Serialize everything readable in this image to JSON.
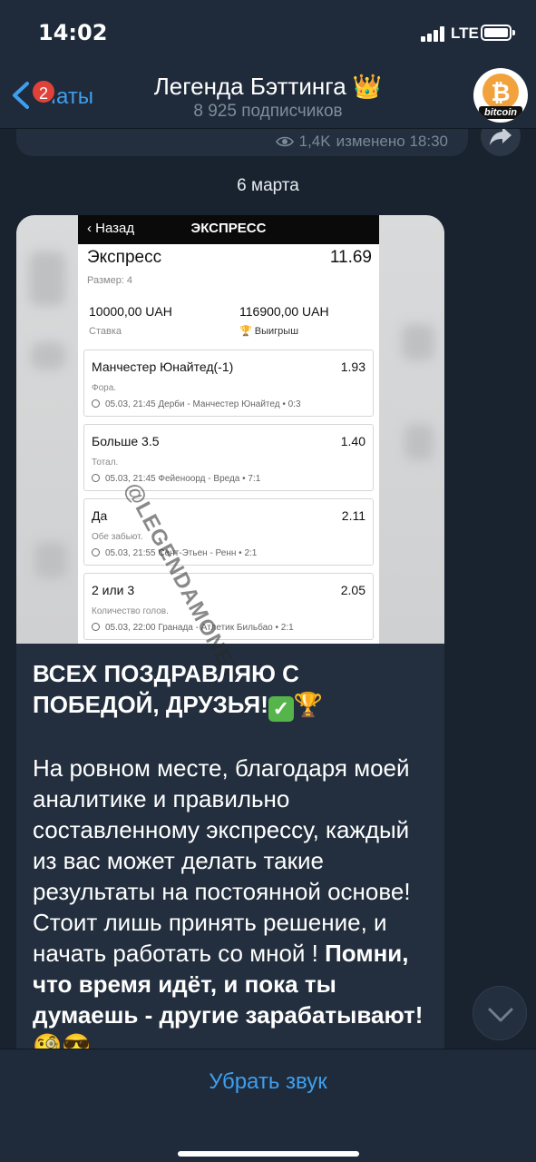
{
  "status": {
    "time": "14:02",
    "network": "LTE"
  },
  "nav": {
    "back_label": "Чаты",
    "unread_badge": "2",
    "title": "Легенда Бэттинга 👑",
    "subtitle": "8 925 подписчиков",
    "avatar_text": "bitcoin"
  },
  "previous_message": {
    "views": "1,4K",
    "edited": "изменено 18:30"
  },
  "date_separator": "6 марта",
  "bet_slip": {
    "back": "Назад",
    "header": "ЭКСПРЕСС",
    "type": "Экспресс",
    "total_odds": "11.69",
    "size": "Размер: 4",
    "stake_value": "10000,00 UAH",
    "stake_label": "Ставка",
    "win_value": "116900,00 UAH",
    "win_label": "Выигрыш",
    "watermark": "@LEGENDAMONEY",
    "legs": [
      {
        "name": "Манчестер Юнайтед(-1)",
        "odds": "1.93",
        "type": "Фора.",
        "event": "05.03, 21:45 Дерби - Манчестер Юнайтед • 0:3"
      },
      {
        "name": "Больше 3.5",
        "odds": "1.40",
        "type": "Тотал.",
        "event": "05.03, 21:45 Фейеноорд - Вреда • 7:1"
      },
      {
        "name": "Да",
        "odds": "2.11",
        "type": "Обе забьют.",
        "event": "05.03, 21:55 Сент-Этьен - Ренн • 2:1"
      },
      {
        "name": "2 или 3",
        "odds": "2.05",
        "type": "Количество голов.",
        "event": "05.03, 22:00 Гранада - Атлетик Бильбао • 2:1"
      }
    ]
  },
  "message": {
    "headline": "ВСЕХ ПОЗДРАВЛЯЮ С ПОБЕДОЙ, ДРУЗЬЯ!",
    "headline_emoji": "✓🏆",
    "body": "На ровном месте, благодаря моей аналитике и правильно составленному экспрессу, каждый из вас может делать такие результаты на постоянной основе! Стоит лишь принять решение, и начать работать со мной ! ",
    "body_bold": "Помни, что время идёт, и пока ты думаешь - другие зарабатывают!",
    "body_emoji": "🧐😎"
  },
  "bottom": {
    "mute_label": "Убрать звук"
  }
}
